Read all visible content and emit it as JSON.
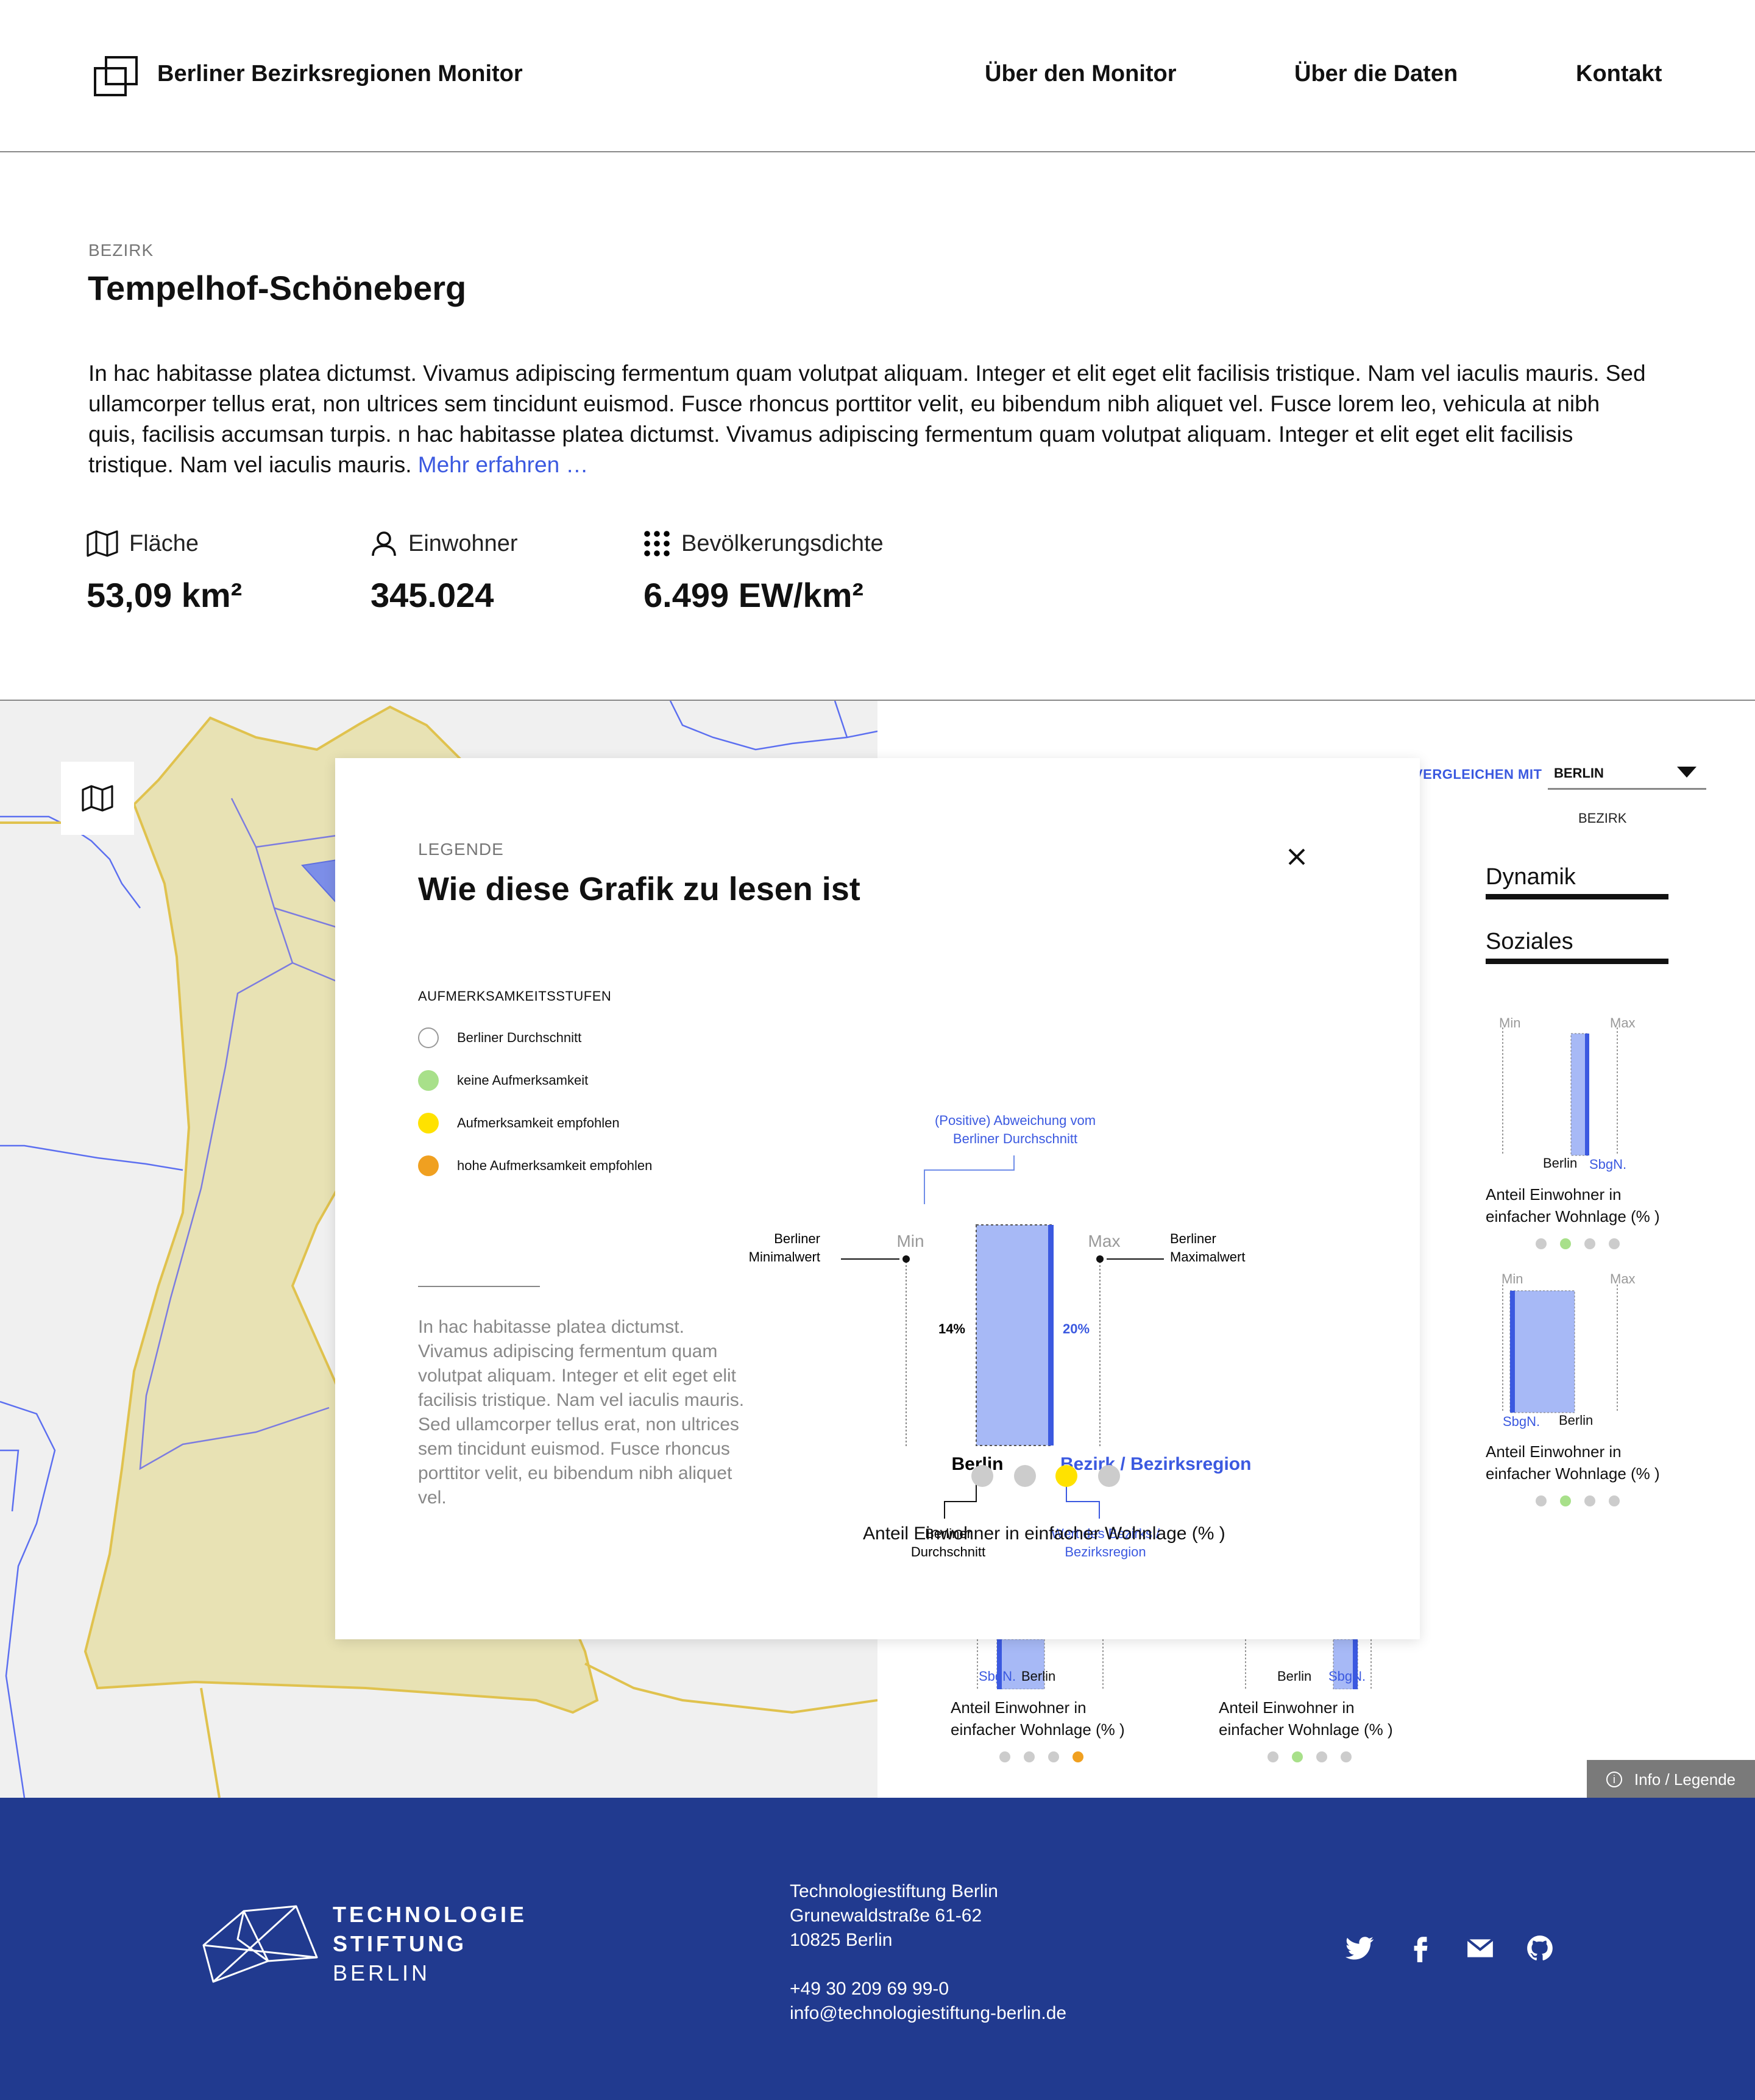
{
  "header": {
    "brand": "Berliner Bezirksregionen Monitor",
    "nav": [
      "Über den Monitor",
      "Über die Daten",
      "Kontakt"
    ]
  },
  "intro": {
    "eyebrow": "BEZIRK",
    "title": "Tempelhof-Schöneberg",
    "text": "In hac habitasse platea dictumst. Vivamus adipiscing fermentum quam volutpat aliquam. Integer et elit eget elit facilisis tristique. Nam vel iaculis mauris. Sed ullamcorper tellus erat, non ultrices sem tincidunt euismod. Fusce rhoncus porttitor velit, eu bibendum nibh aliquet vel. Fusce lorem leo, vehicula at nibh quis, facilisis accumsan turpis. n hac habitasse platea dictumst. Vivamus adipiscing fermentum quam volutpat aliquam. Integer et elit eget elit facilisis tristique. Nam vel iaculis mauris.",
    "more": "Mehr erfahren …"
  },
  "stats": [
    {
      "label": "Fläche",
      "value": "53,09 km²",
      "icon": "map-icon"
    },
    {
      "label": "Einwohner",
      "value": "345.024",
      "icon": "person-icon"
    },
    {
      "label": "Bevölkerungsdichte",
      "value": "6.499 EW/km²",
      "icon": "dots-grid-icon"
    }
  ],
  "compare": {
    "label": "VERGLEICHEN MIT",
    "selected": "BERLIN",
    "option": "BEZIRK"
  },
  "tabs": [
    "Dynamik",
    "Soziales"
  ],
  "mini": {
    "min": "Min",
    "max": "Max",
    "berlin": "Berlin",
    "region": "SbgN.",
    "caption": "Anteil Einwohner in einfacher Wohnlage (% )"
  },
  "info_button": "Info / Legende",
  "modal": {
    "eyebrow": "LEGENDE",
    "title": "Wie diese Grafik zu lesen ist",
    "levels_title": "AUFMERKSAMKEITSSTUFEN",
    "levels": [
      {
        "label": "Berliner Durchschnitt",
        "color": "#ffffff"
      },
      {
        "label": "keine Aufmerksamkeit",
        "color": "#a8e08a"
      },
      {
        "label": "Aufmerksamkeit empfohlen",
        "color": "#ffe200"
      },
      {
        "label": "hohe Aufmerksamkeit empfohlen",
        "color": "#f0a020"
      }
    ],
    "note": "In hac habitasse platea dictumst. Vivamus adipiscing fermentum quam volutpat aliquam. Integer et elit eget elit facilisis tristique. Nam vel iaculis mauris. Sed ullamcorper tellus erat, non ultrices sem tincidunt euismod. Fusce rhoncus porttitor velit, eu bibendum nibh aliquet vel.",
    "chart": {
      "deviation_label_1": "(Positive) Abweichung vom",
      "deviation_label_2": "Berliner Durchschnitt",
      "min": "Min",
      "max": "Max",
      "minval_1": "Berliner",
      "minval_2": "Minimalwert",
      "maxval_1": "Berliner",
      "maxval_2": "Maximalwert",
      "berlin_value": "14%",
      "region_value": "20%",
      "berlin": "Berlin",
      "region": "Bezirk / Bezirksregion",
      "avg_1": "Berliner",
      "avg_2": "Durchschnitt",
      "regval_1": "Wert des Bezirks /",
      "regval_2": "Bezirksregion"
    },
    "caption": "Anteil Einwohner in einfacher Wohnlage (% )"
  },
  "footer": {
    "name_1": "TECHNOLOGIE",
    "name_2": "STIFTUNG",
    "name_3": "BERLIN",
    "addr_1": "Technologiestiftung Berlin",
    "addr_2": "Grunewaldstraße 61-62",
    "addr_3": "10825 Berlin",
    "phone": "+49 30 209 69 99-0",
    "email": "info@technologiestiftung-berlin.de",
    "social": [
      "twitter-icon",
      "facebook-icon",
      "mail-icon",
      "github-icon"
    ]
  },
  "colors": {
    "accent": "#3b59e0",
    "bar_fill": "#a7b9f6",
    "footer": "#213a8f",
    "map_region": "#e8e2b4"
  }
}
